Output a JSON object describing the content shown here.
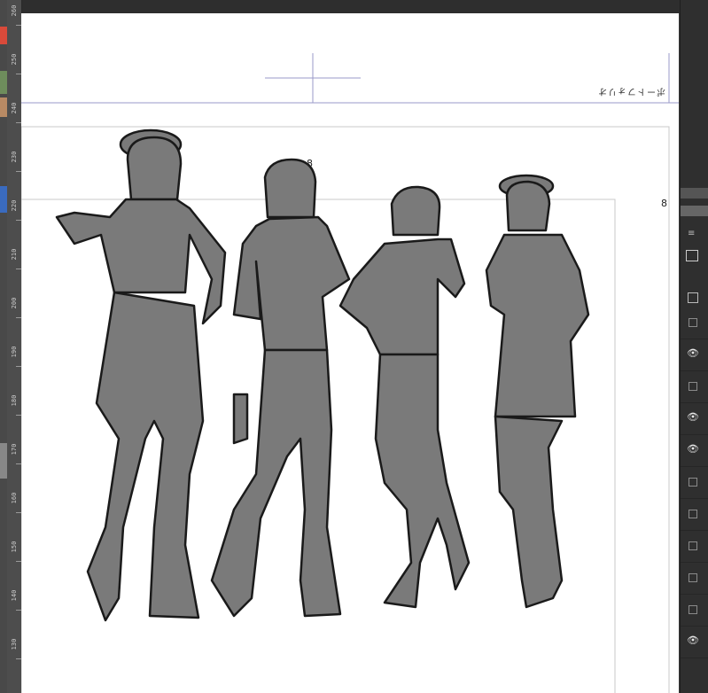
{
  "left_strip": {
    "chips": [
      "#d94a3a",
      "#6e8d5c",
      "#b88a64",
      "#3a6bbf",
      "#888888"
    ]
  },
  "ruler": {
    "labels": [
      "260",
      "250",
      "240",
      "230",
      "220",
      "210",
      "200",
      "190",
      "180",
      "170",
      "160",
      "150",
      "140",
      "130"
    ]
  },
  "canvas": {
    "guide_text": "ポートフォリオ",
    "page_number_left": "8",
    "page_number_right": "8"
  },
  "layers_panel": {
    "rows": [
      {
        "visible": false
      },
      {
        "visible": true
      },
      {
        "visible": false
      },
      {
        "visible": true
      },
      {
        "visible": true
      },
      {
        "visible": false
      },
      {
        "visible": false
      },
      {
        "visible": false
      },
      {
        "visible": false
      },
      {
        "visible": false
      },
      {
        "visible": true
      }
    ],
    "eye_glyph": "👁"
  },
  "colors": {
    "ink": "#1a1a1a",
    "fill_gray": "#7a7a7a",
    "guide_blue": "#9a9ac8"
  }
}
